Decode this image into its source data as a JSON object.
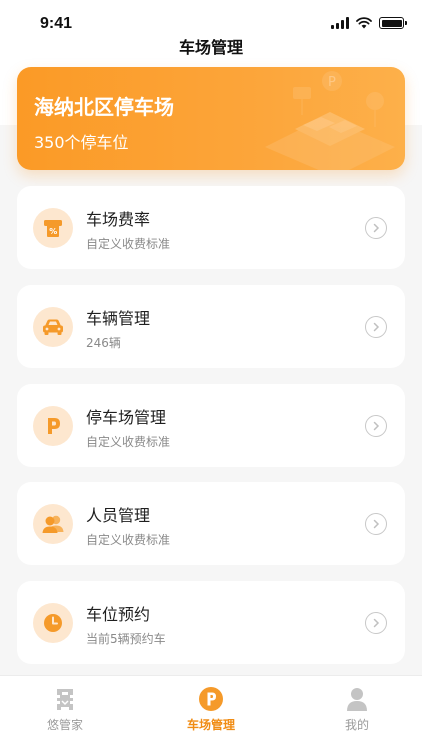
{
  "status_bar": {
    "time": "9:41"
  },
  "nav": {
    "title": "车场管理"
  },
  "hero": {
    "title": "海纳北区停车场",
    "subtitle": "350个停车位"
  },
  "menu": [
    {
      "icon": "fee-rate-icon",
      "title": "车场费率",
      "subtitle": "自定义收费标准"
    },
    {
      "icon": "car-icon",
      "title": "车辆管理",
      "subtitle": "246辆"
    },
    {
      "icon": "parking-icon",
      "title": "停车场管理",
      "subtitle": "自定义收费标准"
    },
    {
      "icon": "people-icon",
      "title": "人员管理",
      "subtitle": "自定义收费标准"
    },
    {
      "icon": "clock-icon",
      "title": "车位预约",
      "subtitle": "当前5辆预约车"
    }
  ],
  "tabbar": {
    "items": [
      {
        "label": "悠管家",
        "icon": "butler-icon",
        "active": false
      },
      {
        "label": "车场管理",
        "icon": "parking-tab-icon",
        "active": true
      },
      {
        "label": "我的",
        "icon": "user-icon",
        "active": false
      }
    ]
  },
  "colors": {
    "accent": "#fb9a26",
    "icon_bg": "#fde7cf",
    "inactive": "#9a9a9a"
  }
}
